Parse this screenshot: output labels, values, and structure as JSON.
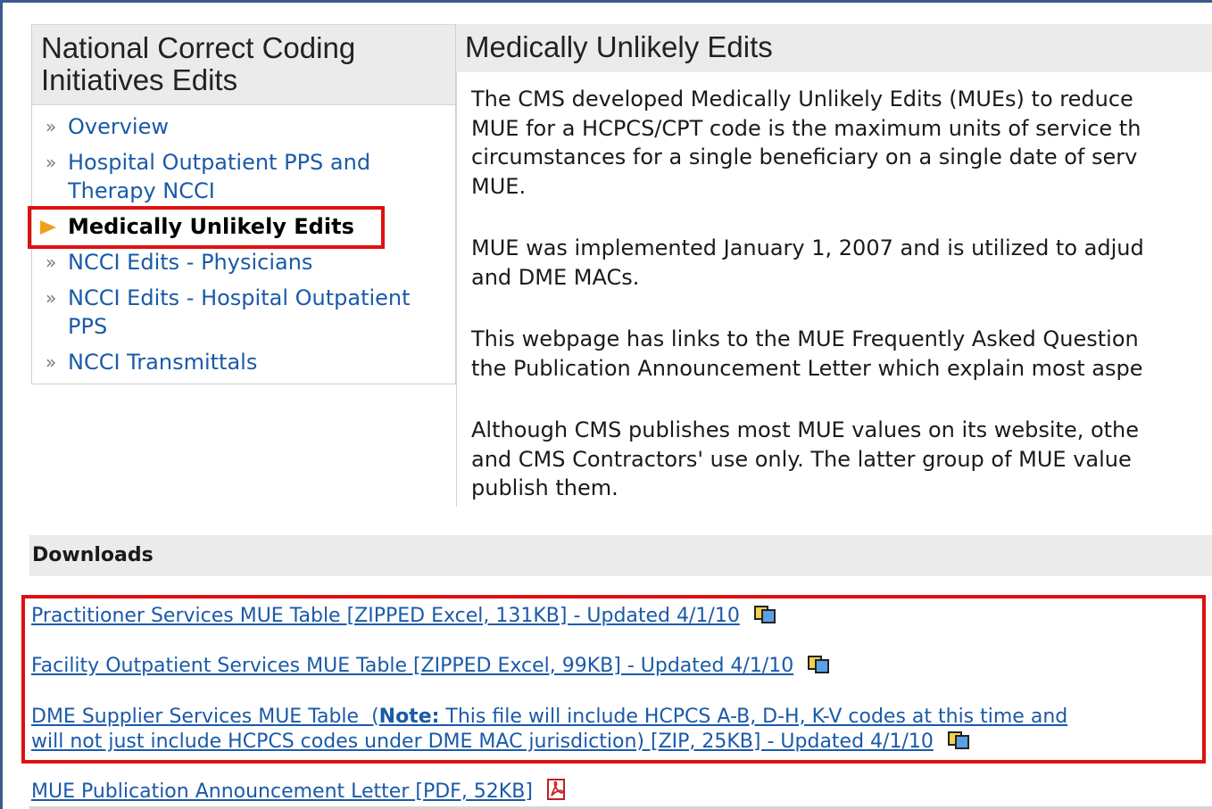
{
  "sidebar": {
    "title": "National Correct Coding Initiatives Edits",
    "items": [
      {
        "label": "Overview"
      },
      {
        "label": "Hospital Outpatient PPS and Therapy NCCI"
      },
      {
        "label": "Medically Unlikely Edits",
        "active": true
      },
      {
        "label": "NCCI Edits - Physicians"
      },
      {
        "label": "NCCI Edits - Hospital Outpatient PPS"
      },
      {
        "label": "NCCI Transmittals"
      }
    ]
  },
  "main": {
    "title": "Medically Unlikely Edits",
    "paragraphs": [
      "The CMS developed Medically Unlikely Edits (MUEs) to reduce\nMUE for a HCPCS/CPT code is the maximum units of service th\ncircumstances for a single beneficiary on a single date of serv\nMUE.",
      "MUE was implemented January 1, 2007 and is utilized to adjud\nand DME MACs.",
      "This webpage has links to the MUE Frequently Asked Question\nthe Publication Announcement Letter which explain most aspe",
      "Although CMS publishes most MUE values on its website, othe\nand CMS Contractors' use only.  The latter group of MUE value\npublish them."
    ]
  },
  "downloads": {
    "header": "Downloads",
    "items": [
      {
        "text": "Practitioner Services MUE Table [ZIPPED Excel, 131KB] - Updated 4/1/10",
        "icon": "excel-icon"
      },
      {
        "text": "Facility Outpatient Services MUE Table [ZIPPED Excel, 99KB] - Updated 4/1/10",
        "icon": "excel-icon"
      },
      {
        "prefix": "DME Supplier Services MUE Table  (",
        "note_label": "Note:",
        "line1_rest": " This file will include HCPCS A-B, D-H, K-V codes at this time and",
        "line2": "will not just include HCPCS codes under DME MAC jurisdiction) [ZIP, 25KB] - Updated 4/1/10",
        "icon": "excel-icon"
      },
      {
        "text": "MUE Publication Announcement Letter [PDF, 52KB]",
        "icon": "pdf-icon"
      }
    ]
  },
  "colors": {
    "link": "#1a5aa8",
    "highlight": "#e01010",
    "accent_arrow": "#f0a020",
    "header_bg": "#ebebeb"
  }
}
